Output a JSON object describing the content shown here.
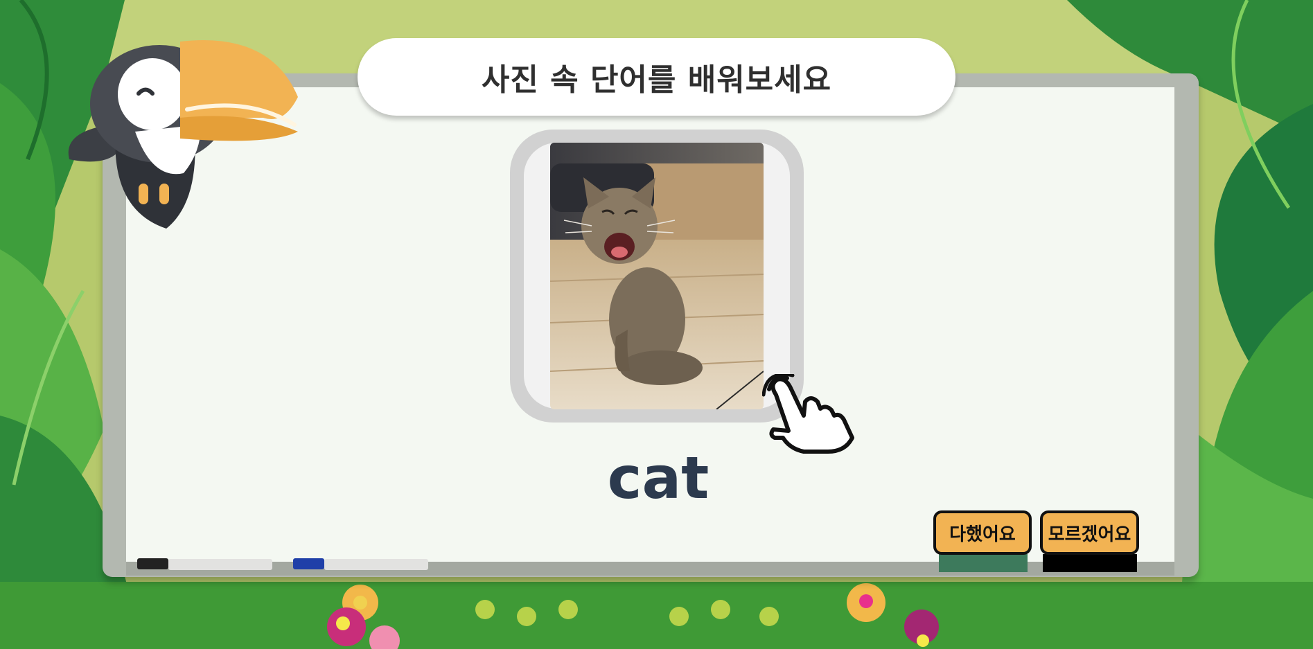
{
  "header": {
    "title": "사진 속 단어를 배워보세요"
  },
  "card": {
    "image_subject": "yawning tabby kitten sitting on wooden floor",
    "word": "cat"
  },
  "buttons": {
    "done_label": "다했어요",
    "dont_know_label": "모르겠어요"
  },
  "colors": {
    "button_fill": "#f2b353",
    "done_base": "#3d7a5c",
    "dont_know_base": "#000000",
    "word_text": "#2c3a4e",
    "frame": "#d1d1d1"
  },
  "icons": [
    "toucan-mascot",
    "hand-pointer-icon",
    "black-marker",
    "blue-marker"
  ]
}
